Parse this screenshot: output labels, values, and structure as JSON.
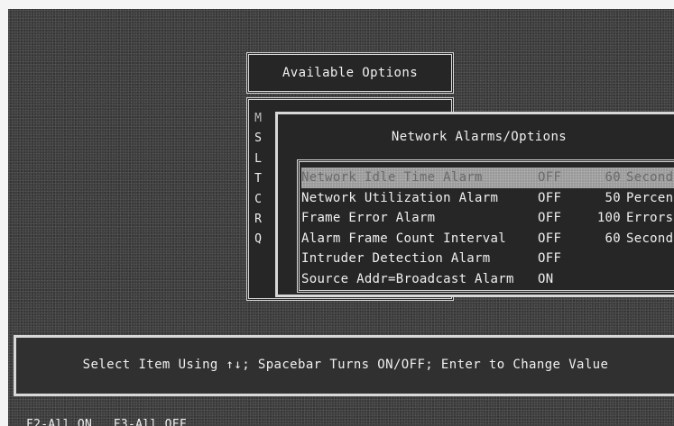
{
  "available_options": {
    "title": "Available Options",
    "items": [
      {
        "letter": "M",
        "selected": true
      },
      {
        "letter": "S",
        "selected": false
      },
      {
        "letter": "L",
        "selected": false
      },
      {
        "letter": "T",
        "selected": false
      },
      {
        "letter": "C",
        "selected": false
      },
      {
        "letter": "R",
        "selected": false
      },
      {
        "letter": "Q",
        "selected": false
      }
    ]
  },
  "network_alarms": {
    "title": "Network Alarms/Options",
    "rows": [
      {
        "name": "Network Idle Time Alarm",
        "state": "OFF",
        "value": "60",
        "unit": "Seconds",
        "selected": true
      },
      {
        "name": "Network Utilization Alarm",
        "state": "OFF",
        "value": "50",
        "unit": "Percent",
        "selected": false
      },
      {
        "name": "Frame Error Alarm",
        "state": "OFF",
        "value": "100",
        "unit": "Errors",
        "selected": false
      },
      {
        "name": "Alarm Frame Count Interval",
        "state": "OFF",
        "value": "60",
        "unit": "Seconds",
        "selected": false
      },
      {
        "name": "Intruder Detection Alarm",
        "state": "OFF",
        "value": "",
        "unit": "",
        "selected": false
      },
      {
        "name": "Source Addr=Broadcast Alarm",
        "state": "ON",
        "value": "",
        "unit": "",
        "selected": false
      }
    ]
  },
  "status_bar": {
    "text": "Select Item Using ↑↓; Spacebar Turns ON/OFF; Enter to Change Value"
  },
  "function_keys": [
    {
      "label": "F2-All ON"
    },
    {
      "label": "F3-All OFF"
    }
  ]
}
